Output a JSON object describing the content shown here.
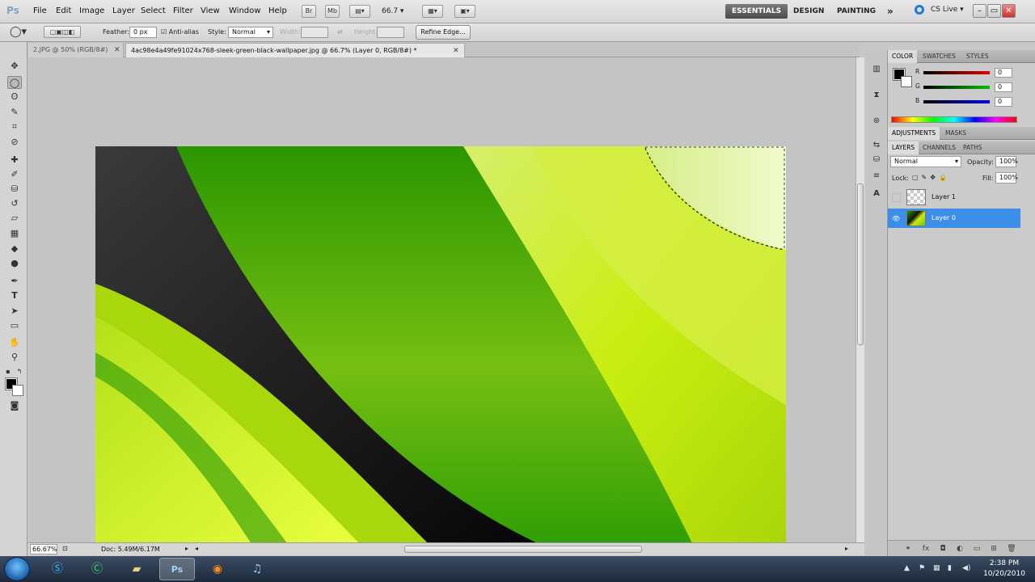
{
  "app": {
    "logo": "Ps"
  },
  "menu": [
    "File",
    "Edit",
    "Image",
    "Layer",
    "Select",
    "Filter",
    "View",
    "Window",
    "Help"
  ],
  "menubar_icons": [
    "Br",
    "Mb"
  ],
  "zoom_level": "66.7",
  "workspaces": [
    "ESSENTIALS",
    "DESIGN",
    "PAINTING"
  ],
  "workspace_more": "»",
  "cs_live": "CS Live",
  "window_controls": {
    "minimize": "–",
    "restore": "▭",
    "close": "✕"
  },
  "options": {
    "feather_label": "Feather:",
    "feather_value": "0 px",
    "antialias_label": "Anti-alias",
    "antialias_checked": true,
    "style_label": "Style:",
    "style_value": "Normal",
    "width_label": "Width:",
    "height_label": "Height:",
    "refine_edge": "Refine Edge..."
  },
  "tabs": [
    {
      "label": "2.JPG @ 50% (RGB/8#)"
    },
    {
      "label": "4ac98e4a49fe91024x768-sleek-green-black-wallpaper.jpg @ 66.7% (Layer 0, RGB/8#) *"
    }
  ],
  "tab_close": "✕",
  "status": {
    "zoom": "66.67%",
    "doc": "Doc: 5.49M/6.17M"
  },
  "color_panel": {
    "tabs": [
      "COLOR",
      "SWATCHES",
      "STYLES"
    ],
    "channels": [
      {
        "label": "R",
        "value": "0",
        "color": "#e00000"
      },
      {
        "label": "G",
        "value": "0",
        "color": "#00b000"
      },
      {
        "label": "B",
        "value": "0",
        "color": "#0000e0"
      }
    ]
  },
  "adjustments_tabs": [
    "ADJUSTMENTS",
    "MASKS"
  ],
  "layers_panel": {
    "tabs": [
      "LAYERS",
      "CHANNELS",
      "PATHS"
    ],
    "blend_mode": "Normal",
    "opacity_label": "Opacity:",
    "opacity_value": "100%",
    "lock_label": "Lock:",
    "fill_label": "Fill:",
    "fill_value": "100%",
    "layers": [
      {
        "name": "Layer 1",
        "visible": false,
        "selected": false
      },
      {
        "name": "Layer 0",
        "visible": true,
        "selected": true
      }
    ]
  },
  "taskbar": {
    "apps": [
      "skype-icon",
      "camtasia-icon",
      "folder-icon",
      "photoshop-icon",
      "firefox-icon",
      "itunes-icon"
    ],
    "ps_label": "Ps",
    "time": "2:38 PM",
    "date": "10/20/2010"
  },
  "colors": {
    "accent": "#3b8fe8",
    "wallpaper_green": "#4caf1a",
    "wallpaper_lime": "#c6f00c"
  }
}
